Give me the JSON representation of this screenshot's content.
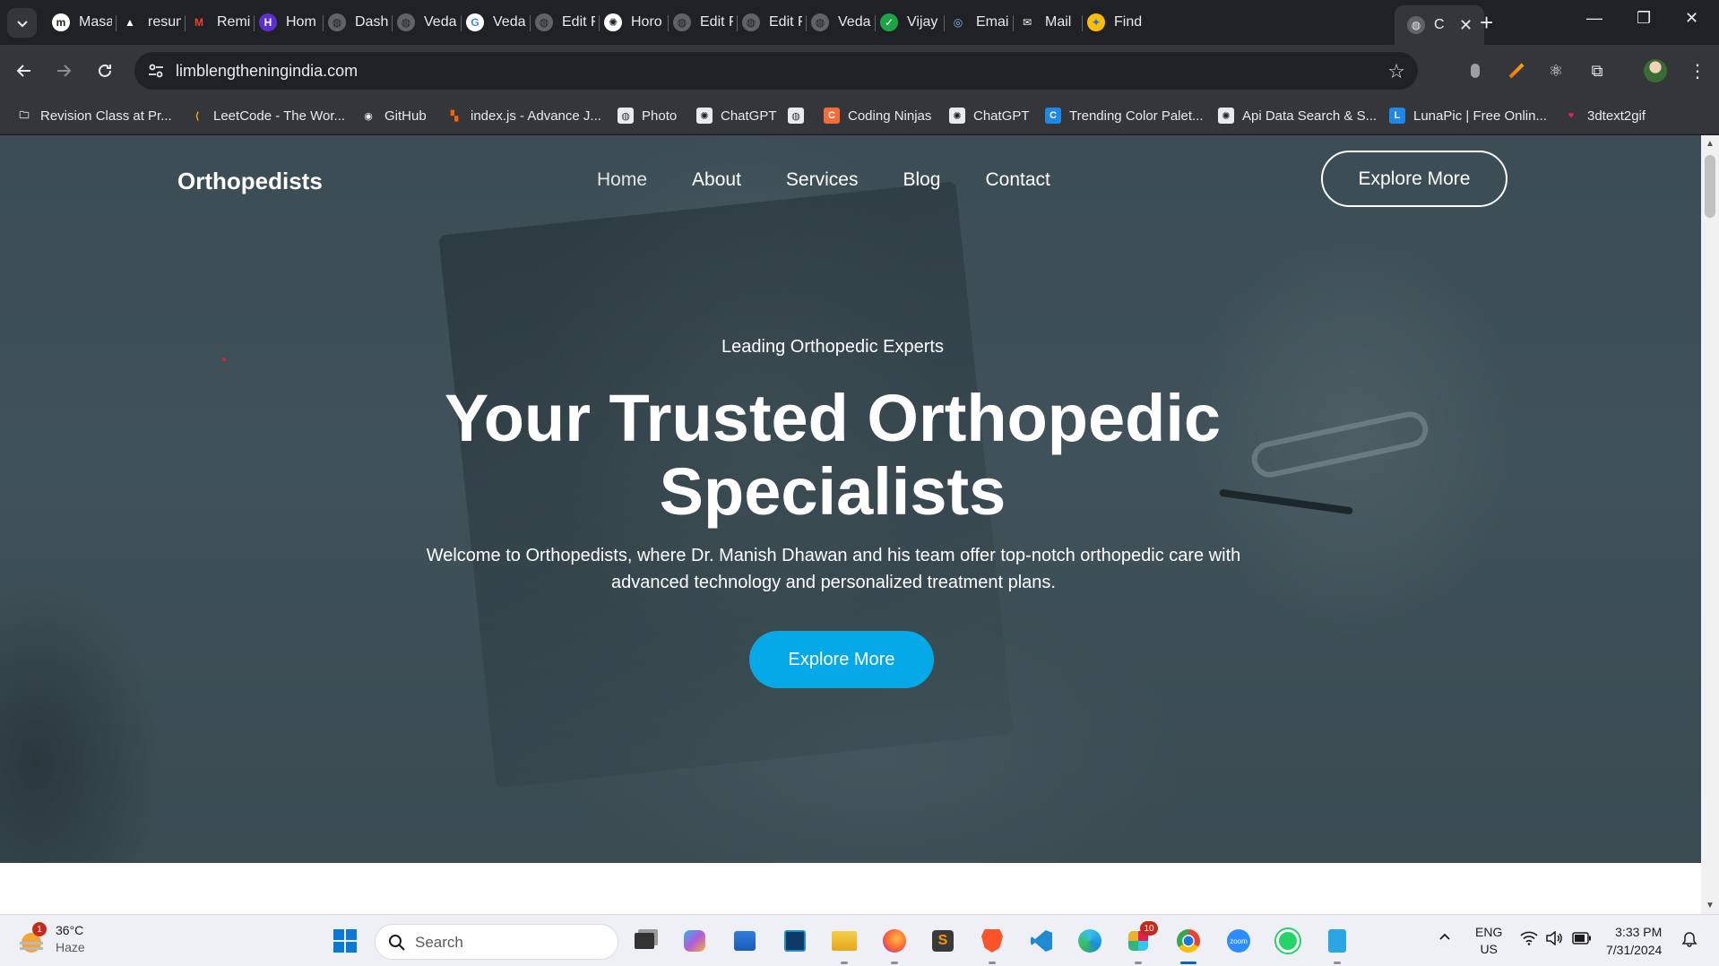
{
  "browser": {
    "tabs": [
      {
        "label": "Masa",
        "icon": "m-icon"
      },
      {
        "label": "resum",
        "icon": "drive-icon"
      },
      {
        "label": "Remi",
        "icon": "gmail-icon"
      },
      {
        "label": "Hom",
        "icon": "h-icon"
      },
      {
        "label": "Dash",
        "icon": "globe-icon"
      },
      {
        "label": "Veda",
        "icon": "globe-icon"
      },
      {
        "label": "Veda",
        "icon": "google-icon"
      },
      {
        "label": "Edit F",
        "icon": "globe-icon"
      },
      {
        "label": "Horo",
        "icon": "chatgpt-icon"
      },
      {
        "label": "Edit F",
        "icon": "globe-icon"
      },
      {
        "label": "Edit F",
        "icon": "globe-icon"
      },
      {
        "label": "Veda",
        "icon": "globe-icon"
      },
      {
        "label": "Vijay",
        "icon": "check-icon"
      },
      {
        "label": "Email",
        "icon": "swirl-icon"
      },
      {
        "label": "Mail",
        "icon": "mail-icon"
      },
      {
        "label": "Find",
        "icon": "pinwheel-icon"
      }
    ],
    "active_tab": {
      "label": "C",
      "icon": "globe-icon"
    },
    "address": "limblengtheningindia.com",
    "bookmarks": [
      {
        "label": "Revision Class at Pr...",
        "icon": "folder-icon"
      },
      {
        "label": "LeetCode - The Wor...",
        "icon": "leetcode-icon"
      },
      {
        "label": "GitHub",
        "icon": "github-icon"
      },
      {
        "label": "index.js - Advance J...",
        "icon": "replit-icon"
      },
      {
        "label": "Photo",
        "icon": "globe-icon"
      },
      {
        "label": "ChatGPT",
        "icon": "chatgpt-icon"
      },
      {
        "label": "",
        "icon": "globe-icon"
      },
      {
        "label": "Coding Ninjas",
        "icon": "codingninjas-icon"
      },
      {
        "label": "ChatGPT",
        "icon": "chatgpt-icon"
      },
      {
        "label": "Trending Color Palet...",
        "icon": "coolors-icon"
      },
      {
        "label": "Api Data Search & S...",
        "icon": "chatgpt-icon"
      },
      {
        "label": "LunaPic | Free Onlin...",
        "icon": "lunapic-icon"
      },
      {
        "label": "3dtext2gif",
        "icon": "heart-icon"
      }
    ]
  },
  "site": {
    "logo": "Orthopedists",
    "nav": [
      "Home",
      "About",
      "Services",
      "Blog",
      "Contact"
    ],
    "nav_cta": "Explore More",
    "eyebrow": "Leading Orthopedic Experts",
    "headline_line1": "Your Trusted Orthopedic",
    "headline_line2": "Specialists",
    "subtext": "Welcome to Orthopedists, where Dr. Manish Dhawan and his team offer top-notch orthopedic care with advanced technology and personalized treatment plans.",
    "hero_cta": "Explore More",
    "accent_color": "#06a9e8"
  },
  "taskbar": {
    "weather_temp": "36°C",
    "weather_desc": "Haze",
    "weather_badge": "1",
    "search_placeholder": "Search",
    "slack_badge": "10",
    "lang_line1": "ENG",
    "lang_line2": "US",
    "time": "3:33 PM",
    "date": "7/31/2024"
  }
}
